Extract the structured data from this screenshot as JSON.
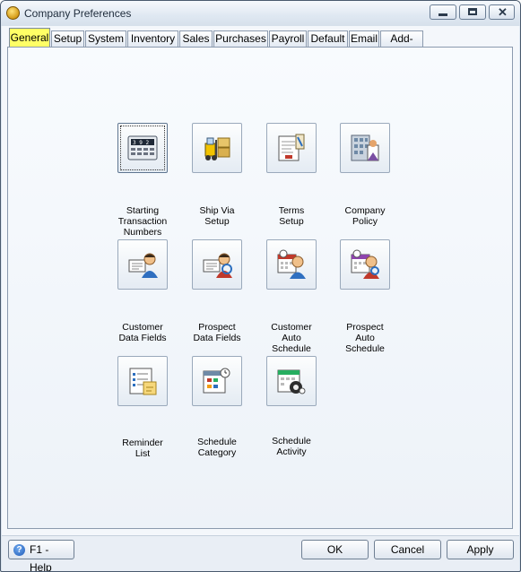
{
  "window": {
    "title": "Company Preferences"
  },
  "tabs": [
    {
      "label": "General"
    },
    {
      "label": "Setup"
    },
    {
      "label": "System"
    },
    {
      "label": "Inventory"
    },
    {
      "label": "Sales"
    },
    {
      "label": "Purchases"
    },
    {
      "label": "Payroll"
    },
    {
      "label": "Default"
    },
    {
      "label": "Email"
    },
    {
      "label": "Add-Ons"
    }
  ],
  "active_tab": "General",
  "items": [
    {
      "label": "Starting\nTransaction\nNumbers",
      "icon": "transaction-numbers-icon"
    },
    {
      "label": "Ship Via\nSetup",
      "icon": "forklift-icon"
    },
    {
      "label": "Terms\nSetup",
      "icon": "terms-document-icon"
    },
    {
      "label": "Company\nPolicy",
      "icon": "company-building-icon"
    },
    {
      "label": "Customer\nData Fields",
      "icon": "customer-data-icon"
    },
    {
      "label": "Prospect\nData Fields",
      "icon": "prospect-data-icon"
    },
    {
      "label": "Customer\nAuto\nSchedule",
      "icon": "customer-schedule-icon"
    },
    {
      "label": "Prospect\nAuto\nSchedule",
      "icon": "prospect-schedule-icon"
    },
    {
      "label": "Reminder\nList",
      "icon": "reminder-list-icon"
    },
    {
      "label": "Schedule\nCategory",
      "icon": "schedule-category-icon"
    },
    {
      "label": "Schedule\nActivity",
      "icon": "schedule-activity-icon"
    }
  ],
  "footer": {
    "help": "F1 - Help",
    "ok": "OK",
    "cancel": "Cancel",
    "apply": "Apply"
  }
}
